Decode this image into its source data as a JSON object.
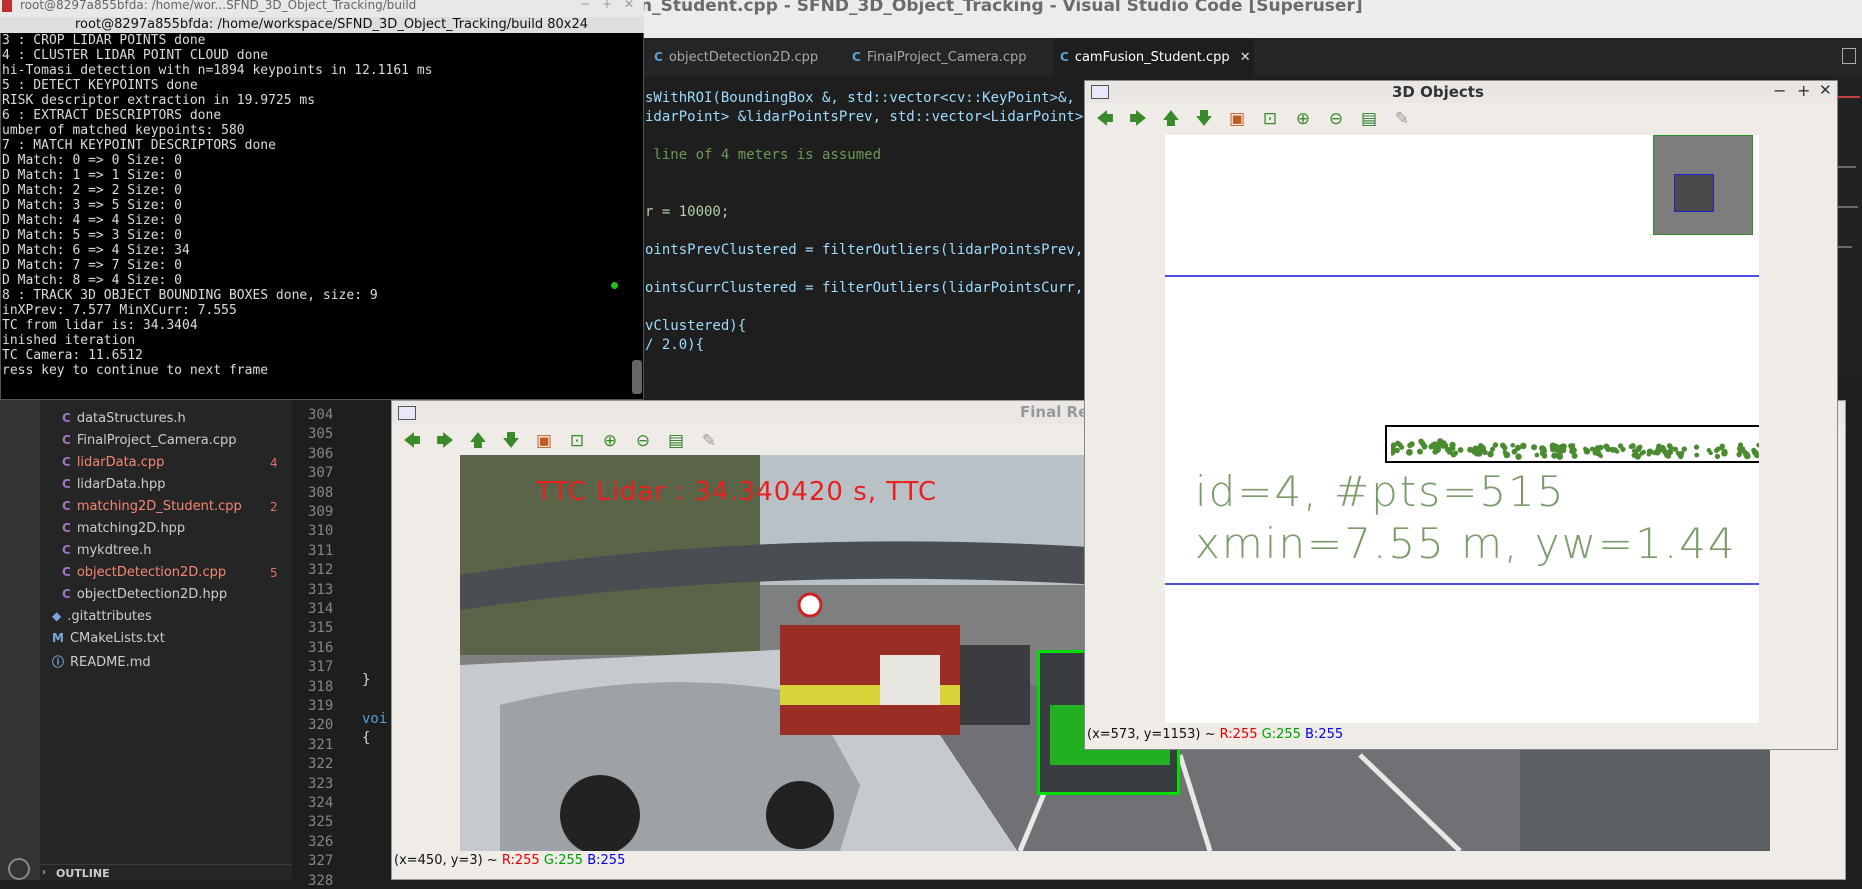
{
  "vscode": {
    "window_title": "n_Student.cpp - SFND_3D_Object_Tracking - Visual Studio Code [Superuser]",
    "tabs": [
      {
        "icon": "C",
        "label": "objectDetection2D.cpp"
      },
      {
        "icon": "C",
        "label": "FinalProject_Camera.cpp"
      },
      {
        "icon": "C",
        "label": "camFusion_Student.cpp",
        "close": "✕"
      }
    ],
    "code_lines": [
      "sWithROI(BoundingBox &, std::vector<cv::KeyPoint>&, std::vector<cv::KeyP",
      "idarPoint> &lidarPointsPrev, std::vector<LidarPoint>",
      "",
      " line of 4 meters is assumed",
      "",
      "",
      "r = 10000;",
      "",
      "ointsPrevClustered = filterOutliers(lidarPointsPrev,",
      "",
      "ointsCurrClustered = filterOutliers(lidarPointsCurr,",
      "",
      "vClustered){",
      "/ 2.0){"
    ],
    "line_numbers": [
      "304",
      "305",
      "306",
      "307",
      "308",
      "309",
      "310",
      "311",
      "312",
      "313",
      "314",
      "315",
      "316",
      "317",
      "318",
      "319",
      "320",
      "321",
      "322",
      "323",
      "324",
      "325",
      "326",
      "327",
      "328"
    ],
    "code_snippets": {
      "brace_close": "}",
      "void": "voi",
      "brace_open": "{"
    },
    "outline_label": "OUTLINE",
    "explorer_items": [
      {
        "icon": "C",
        "label": "dataStructures.h",
        "color": "#cccccc",
        "badge": ""
      },
      {
        "icon": "C",
        "label": "FinalProject_Camera.cpp",
        "color": "#cccccc",
        "badge": ""
      },
      {
        "icon": "C",
        "label": "lidarData.cpp",
        "color": "#f48771",
        "badge": "4"
      },
      {
        "icon": "C",
        "label": "lidarData.hpp",
        "color": "#cccccc",
        "badge": ""
      },
      {
        "icon": "C",
        "label": "matching2D_Student.cpp",
        "color": "#f48771",
        "badge": "2"
      },
      {
        "icon": "C",
        "label": "matching2D.hpp",
        "color": "#cccccc",
        "badge": ""
      },
      {
        "icon": "C",
        "label": "mykdtree.h",
        "color": "#cccccc",
        "badge": ""
      },
      {
        "icon": "C",
        "label": "objectDetection2D.cpp",
        "color": "#f48771",
        "badge": "5"
      },
      {
        "icon": "C",
        "label": "objectDetection2D.hpp",
        "color": "#cccccc",
        "badge": ""
      },
      {
        "icon": "◆",
        "label": ".gitattributes",
        "color": "#cccccc",
        "badge": ""
      },
      {
        "icon": "M",
        "label": "CMakeLists.txt",
        "color": "#cccccc",
        "badge": ""
      },
      {
        "icon": "ⓘ",
        "label": "README.md",
        "color": "#cccccc",
        "badge": ""
      }
    ]
  },
  "terminal": {
    "title": "root@8297a855bfda: /home/wor...SFND_3D_Object_Tracking/build",
    "subtitle": "root@8297a855bfda: /home/workspace/SFND_3D_Object_Tracking/build 80x24",
    "lines": [
      "3 : CROP LIDAR POINTS done",
      "4 : CLUSTER LIDAR POINT CLOUD done",
      "hi-Tomasi detection with n=1894 keypoints in 12.1161 ms",
      "5 : DETECT KEYPOINTS done",
      "RISK descriptor extraction in 19.9725 ms",
      "6 : EXTRACT DESCRIPTORS done",
      "umber of matched keypoints: 580",
      "7 : MATCH KEYPOINT DESCRIPTORS done",
      "D Match: 0 => 0 Size: 0",
      "D Match: 1 => 1 Size: 0",
      "D Match: 2 => 2 Size: 0",
      "D Match: 3 => 5 Size: 0",
      "D Match: 4 => 4 Size: 0",
      "D Match: 5 => 3 Size: 0",
      "D Match: 6 => 4 Size: 34",
      "D Match: 7 => 7 Size: 0",
      "D Match: 8 => 4 Size: 0",
      "8 : TRACK 3D OBJECT BOUNDING BOXES done, size: 9",
      "inXPrev: 7.577 MinXCurr: 7.555",
      "TC from lidar is: 34.3404",
      "inished iteration",
      "TC Camera: 11.6512",
      "ress key to continue to next frame"
    ]
  },
  "final_window": {
    "title": "Final Re",
    "overlay_text": "TTC Lidar : 34.340420 s, TTC",
    "status": {
      "coords": "(x=450, y=3) ~",
      "r": "R:255",
      "g": "G:255",
      "b": "B:255"
    }
  },
  "objects_window": {
    "title": "3D Objects",
    "text_line1": "id=4, #pts=515",
    "text_line2": "xmin=7.55 m, yw=1.44",
    "status": {
      "coords": "(x=573, y=1153) ~",
      "r": "R:255",
      "g": "G:255",
      "b": "B:255"
    }
  },
  "toolbar_icons": [
    "arrow-left-icon",
    "arrow-right-icon",
    "arrow-up-icon",
    "arrow-down-icon",
    "image-icon",
    "zoom-fit-icon",
    "zoom-in-icon",
    "zoom-out-icon",
    "save-icon",
    "properties-icon"
  ],
  "colors": {
    "status_r": "#e00000",
    "status_g": "#00a000",
    "status_b": "#0000e0",
    "overlay_red": "#e82020",
    "box_green": "#00dd00"
  }
}
